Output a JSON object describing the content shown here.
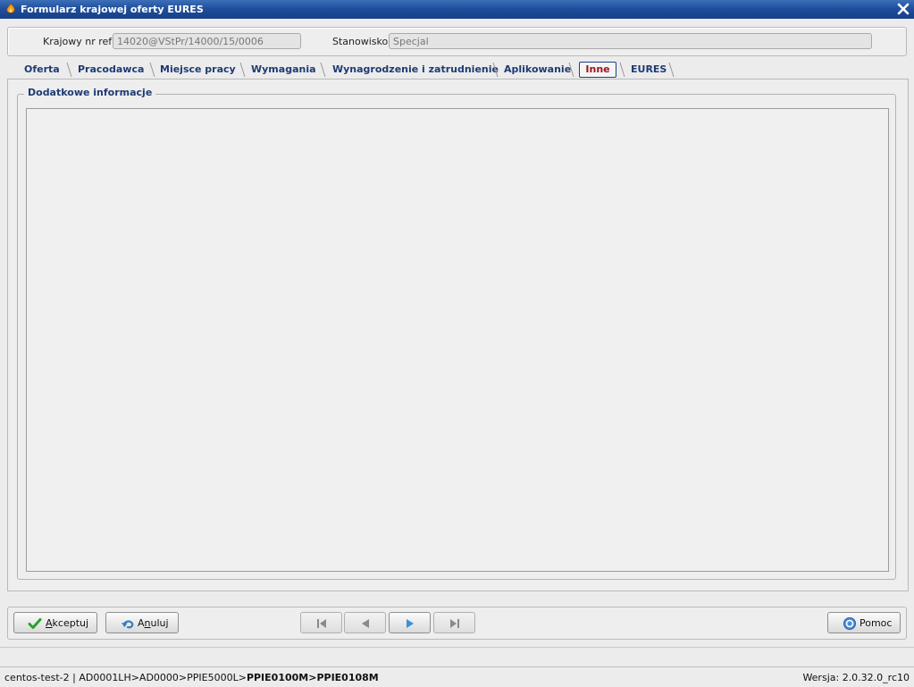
{
  "window": {
    "title": "Formularz krajowej oferty EURES",
    "icon": "app-flame-icon",
    "close_icon": "close-icon"
  },
  "header": {
    "ref_label": "Krajowy nr ref:",
    "ref_value": "14020@VStPr/14000/15/0006",
    "position_label": "Stanowisko:",
    "position_value": "Specjal"
  },
  "tabs": [
    {
      "label": "Oferta",
      "active": false
    },
    {
      "label": "Pracodawca",
      "active": false
    },
    {
      "label": "Miejsce pracy",
      "active": false
    },
    {
      "label": "Wymagania",
      "active": false
    },
    {
      "label": "Wynagrodzenie i zatrudnienie",
      "active": false
    },
    {
      "label": "Aplikowanie",
      "active": false
    },
    {
      "label": "Inne",
      "active": true
    },
    {
      "label": "EURES",
      "active": false
    }
  ],
  "content": {
    "group_title": "Dodatkowe informacje",
    "text_value": ""
  },
  "buttons": {
    "accept": {
      "label_accel": "A",
      "label_rest": "kceptuj",
      "icon": "checkmark-icon"
    },
    "cancel": {
      "label_pre": "A",
      "label_accel": "n",
      "label_rest": "uluj",
      "icon": "undo-arrow-icon"
    },
    "help": {
      "label": "Pomoc",
      "icon": "help-icon"
    },
    "nav": [
      {
        "icon": "first-record-icon",
        "enabled": false
      },
      {
        "icon": "previous-record-icon",
        "enabled": false
      },
      {
        "icon": "next-record-icon",
        "enabled": true
      },
      {
        "icon": "last-record-icon",
        "enabled": false
      }
    ]
  },
  "status": {
    "path_normal": "centos-test-2 | AD0001LH>AD0000>PPIE5000L>",
    "path_bold": "PPIE0100M>PPIE0108M",
    "version": "Wersja: 2.0.32.0_rc10"
  },
  "colors": {
    "title_bar": "#1f4f9c",
    "tab_text": "#1e3b73",
    "active_tab_text": "#a0141c",
    "accept_icon": "#2aa22a",
    "nav_active_icon": "#3b8fd8"
  }
}
